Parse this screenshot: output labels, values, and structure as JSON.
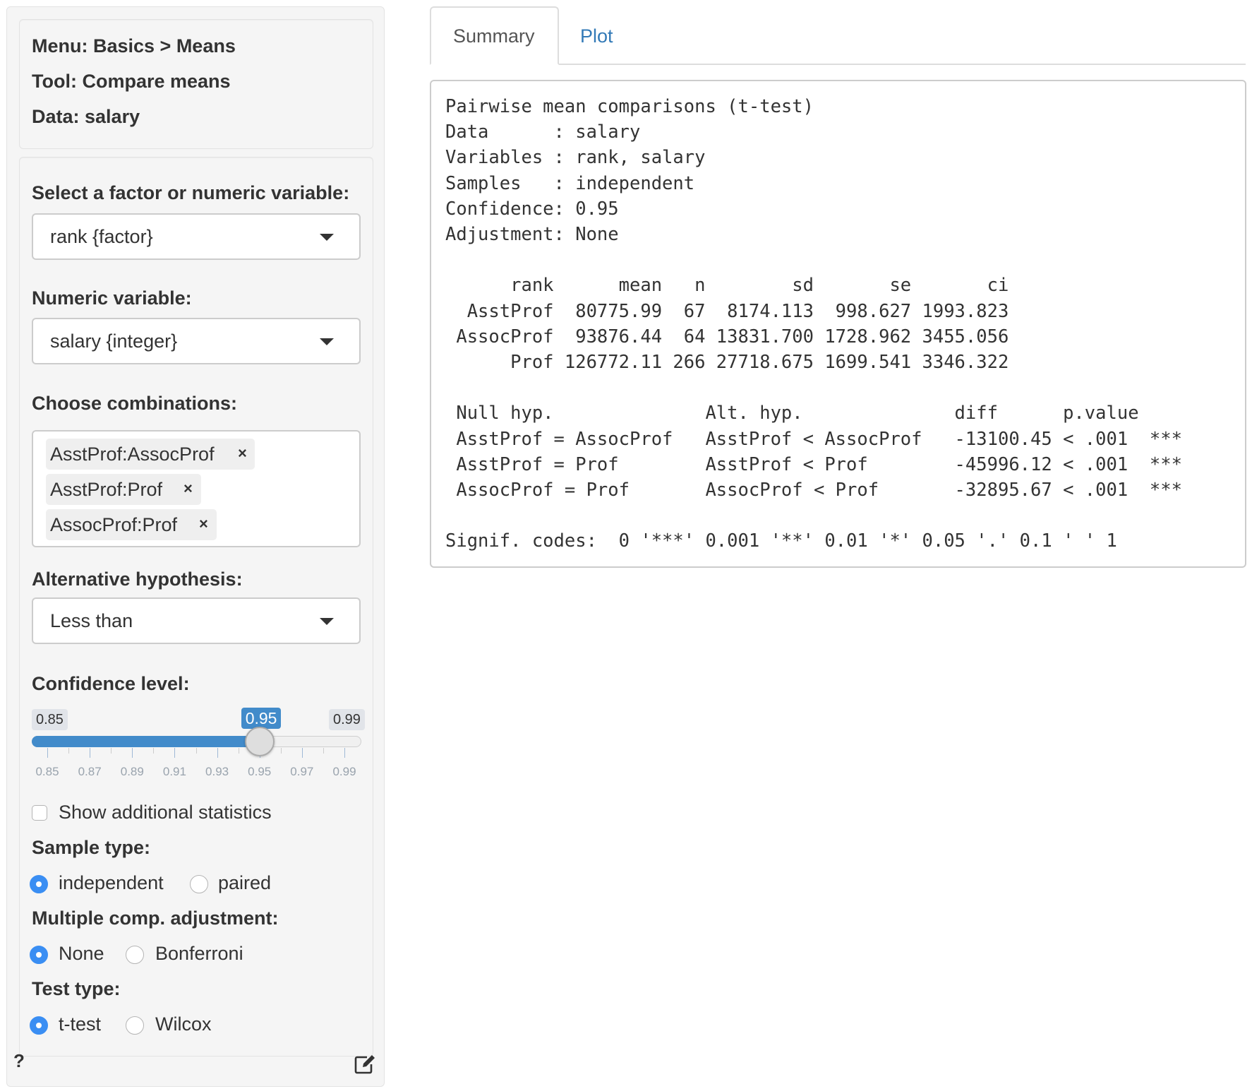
{
  "sidebar": {
    "info": {
      "menu": "Menu: Basics > Means",
      "tool": "Tool: Compare means",
      "data": "Data: salary"
    },
    "factor_var": {
      "label": "Select a factor or numeric variable:",
      "value": "rank {factor}"
    },
    "numeric_var": {
      "label": "Numeric variable:",
      "value": "salary {integer}"
    },
    "combinations": {
      "label": "Choose combinations:",
      "selected": [
        "AsstProf:AssocProf",
        "AsstProf:Prof",
        "AssocProf:Prof"
      ],
      "remove_symbol": "×"
    },
    "alternative": {
      "label": "Alternative hypothesis:",
      "value": "Less than"
    },
    "confidence": {
      "label": "Confidence level:",
      "min": 0.85,
      "max": 0.99,
      "value": 0.95,
      "step": 0.01,
      "min_label": "0.85",
      "max_label": "0.99",
      "value_label": "0.95",
      "tick_labels": [
        "0.85",
        "0.87",
        "0.89",
        "0.91",
        "0.93",
        "0.95",
        "0.97",
        "0.99"
      ]
    },
    "show_stats": {
      "label": "Show additional statistics",
      "checked": false
    },
    "sample_type": {
      "label": "Sample type:",
      "options": [
        {
          "label": "independent",
          "selected": true
        },
        {
          "label": "paired",
          "selected": false
        }
      ]
    },
    "adjustment": {
      "label": "Multiple comp. adjustment:",
      "options": [
        {
          "label": "None",
          "selected": true
        },
        {
          "label": "Bonferroni",
          "selected": false
        }
      ]
    },
    "test_type": {
      "label": "Test type:",
      "options": [
        {
          "label": "t-test",
          "selected": true
        },
        {
          "label": "Wilcox",
          "selected": false
        }
      ]
    },
    "help_label": "?",
    "icons": {
      "help": "question-icon",
      "report": "edit-icon"
    }
  },
  "tabs": [
    {
      "label": "Summary",
      "active": true
    },
    {
      "label": "Plot",
      "active": false
    }
  ],
  "colors": {
    "accent": "#428bca",
    "radio": "#3a8ef3",
    "link": "#337ab7"
  },
  "summary": {
    "title": "Pairwise mean comparisons (t-test)",
    "meta": [
      {
        "key": "Data      ",
        "value": "salary"
      },
      {
        "key": "Variables ",
        "value": "rank, salary"
      },
      {
        "key": "Samples   ",
        "value": "independent"
      },
      {
        "key": "Confidence",
        "value": "0.95"
      },
      {
        "key": "Adjustment",
        "value": "None"
      }
    ],
    "stats_table": {
      "columns": [
        "rank",
        "mean",
        "n",
        "sd",
        "se",
        "ci"
      ],
      "rows": [
        [
          "AsstProf",
          "80775.99",
          "67",
          "8174.113",
          "998.627",
          "1993.823"
        ],
        [
          "AssocProf",
          "93876.44",
          "64",
          "13831.700",
          "1728.962",
          "3455.056"
        ],
        [
          "Prof",
          "126772.11",
          "266",
          "27718.675",
          "1699.541",
          "3346.322"
        ]
      ]
    },
    "tests_table": {
      "columns": [
        "Null hyp.",
        "Alt. hyp.",
        "diff",
        "p.value",
        ""
      ],
      "rows": [
        [
          "AsstProf = AssocProf",
          "AsstProf < AssocProf",
          "-13100.45",
          "< .001",
          "***"
        ],
        [
          "AsstProf = Prof",
          "AsstProf < Prof",
          "-45996.12",
          "< .001",
          "***"
        ],
        [
          "AssocProf = Prof",
          "AssocProf < Prof",
          "-32895.67",
          "< .001",
          "***"
        ]
      ]
    },
    "signif_codes": "Signif. codes:  0 '***' 0.001 '**' 0.01 '*' 0.05 '.' 0.1 ' ' 1"
  }
}
